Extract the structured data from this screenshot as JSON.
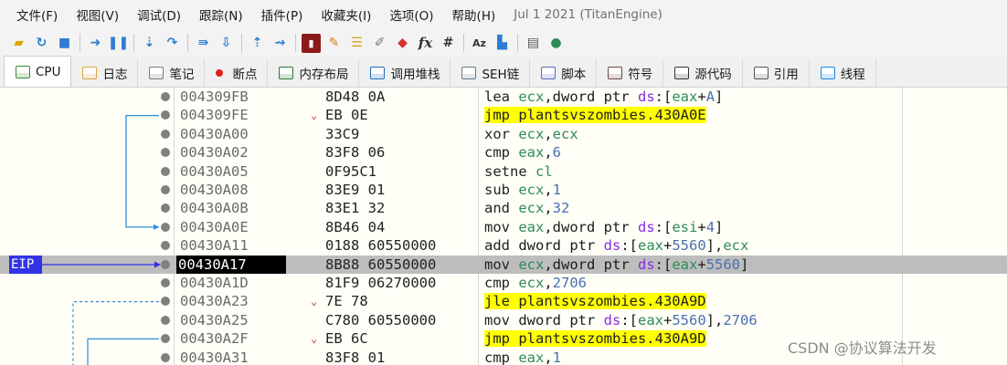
{
  "menu": {
    "items": [
      "文件(F)",
      "视图(V)",
      "调试(D)",
      "跟踪(N)",
      "插件(P)",
      "收藏夹(I)",
      "选项(O)",
      "帮助(H)"
    ],
    "build_date": "Jul 1 2021 (TitanEngine)"
  },
  "toolbar": {
    "icons": [
      "open-folder-icon",
      "restart-icon",
      "stop-icon",
      "run-icon",
      "pause-icon",
      "step-into-icon",
      "step-over-icon",
      "run-until-return-icon",
      "trace-icon",
      "trace-into-icon",
      "animate-icon",
      "console-icon",
      "highlight-icon",
      "patch-icon",
      "comment-icon",
      "label-icon",
      "bookmark-icon"
    ],
    "fx_label": "fx",
    "hash_label": "#",
    "az_label": "Aᴢ"
  },
  "tabs": [
    {
      "label": "CPU",
      "icon": "cpu-icon",
      "color": "#3a8a3a"
    },
    {
      "label": "日志",
      "icon": "log-icon",
      "color": "#d9a441"
    },
    {
      "label": "笔记",
      "icon": "notes-icon",
      "color": "#7a7a7a"
    },
    {
      "label": "断点",
      "icon": "breakpoint-icon",
      "color": "#e02020"
    },
    {
      "label": "内存布局",
      "icon": "memory-map-icon",
      "color": "#2e7d32"
    },
    {
      "label": "调用堆栈",
      "icon": "call-stack-icon",
      "color": "#1e6fb8"
    },
    {
      "label": "SEH链",
      "icon": "seh-chain-icon",
      "color": "#607d8b"
    },
    {
      "label": "脚本",
      "icon": "script-icon",
      "color": "#5c6bc0"
    },
    {
      "label": "符号",
      "icon": "symbols-icon",
      "color": "#6d4c41"
    },
    {
      "label": "源代码",
      "icon": "source-code-icon",
      "color": "#333333"
    },
    {
      "label": "引用",
      "icon": "references-icon",
      "color": "#555555"
    },
    {
      "label": "线程",
      "icon": "threads-icon",
      "color": "#1e88e5"
    }
  ],
  "eip_label": "EIP",
  "rows": [
    {
      "addr": "004309FB",
      "bytes": "8D48 0A",
      "jump": false,
      "tokens": [
        [
          "mn",
          "lea "
        ],
        [
          "reg",
          "ecx"
        ],
        [
          "kw",
          ","
        ],
        [
          "kw",
          "dword ptr "
        ],
        [
          "seg",
          "ds"
        ],
        [
          "kw",
          ":["
        ],
        [
          "reg",
          "eax"
        ],
        [
          "kw",
          "+"
        ],
        [
          "num",
          "A"
        ],
        [
          "kw",
          "]"
        ]
      ]
    },
    {
      "addr": "004309FE",
      "bytes": "EB 0E",
      "jump": true,
      "tokens": [
        [
          "mn",
          "jmp plantsvszombies.430A0E"
        ]
      ]
    },
    {
      "addr": "00430A00",
      "bytes": "33C9",
      "jump": false,
      "tokens": [
        [
          "mn",
          "xor "
        ],
        [
          "reg",
          "ecx"
        ],
        [
          "kw",
          ","
        ],
        [
          "reg",
          "ecx"
        ]
      ]
    },
    {
      "addr": "00430A02",
      "bytes": "83F8 06",
      "jump": false,
      "tokens": [
        [
          "mn",
          "cmp "
        ],
        [
          "reg",
          "eax"
        ],
        [
          "kw",
          ","
        ],
        [
          "num",
          "6"
        ]
      ]
    },
    {
      "addr": "00430A05",
      "bytes": "0F95C1",
      "jump": false,
      "tokens": [
        [
          "mn",
          "setne "
        ],
        [
          "reg",
          "cl"
        ]
      ]
    },
    {
      "addr": "00430A08",
      "bytes": "83E9 01",
      "jump": false,
      "tokens": [
        [
          "mn",
          "sub "
        ],
        [
          "reg",
          "ecx"
        ],
        [
          "kw",
          ","
        ],
        [
          "num",
          "1"
        ]
      ]
    },
    {
      "addr": "00430A0B",
      "bytes": "83E1 32",
      "jump": false,
      "tokens": [
        [
          "mn",
          "and "
        ],
        [
          "reg",
          "ecx"
        ],
        [
          "kw",
          ","
        ],
        [
          "num",
          "32"
        ]
      ]
    },
    {
      "addr": "00430A0E",
      "bytes": "8B46 04",
      "jump": false,
      "tokens": [
        [
          "mn",
          "mov "
        ],
        [
          "reg",
          "eax"
        ],
        [
          "kw",
          ","
        ],
        [
          "kw",
          "dword ptr "
        ],
        [
          "seg",
          "ds"
        ],
        [
          "kw",
          ":["
        ],
        [
          "reg",
          "esi"
        ],
        [
          "kw",
          "+"
        ],
        [
          "num",
          "4"
        ],
        [
          "kw",
          "]"
        ]
      ]
    },
    {
      "addr": "00430A11",
      "bytes": "0188 60550000",
      "jump": false,
      "tokens": [
        [
          "mn",
          "add "
        ],
        [
          "kw",
          "dword ptr "
        ],
        [
          "seg",
          "ds"
        ],
        [
          "kw",
          ":["
        ],
        [
          "reg",
          "eax"
        ],
        [
          "kw",
          "+"
        ],
        [
          "num",
          "5560"
        ],
        [
          "kw",
          "],"
        ],
        [
          "reg",
          "ecx"
        ]
      ]
    },
    {
      "addr": "00430A17",
      "bytes": "8B88 60550000",
      "jump": false,
      "current": true,
      "tokens": [
        [
          "mn",
          "mov "
        ],
        [
          "reg",
          "ecx"
        ],
        [
          "kw",
          ","
        ],
        [
          "kw",
          "dword ptr "
        ],
        [
          "seg",
          "ds"
        ],
        [
          "kw",
          ":["
        ],
        [
          "reg",
          "eax"
        ],
        [
          "kw",
          "+"
        ],
        [
          "num",
          "5560"
        ],
        [
          "kw",
          "]"
        ]
      ]
    },
    {
      "addr": "00430A1D",
      "bytes": "81F9 06270000",
      "jump": false,
      "tokens": [
        [
          "mn",
          "cmp "
        ],
        [
          "reg",
          "ecx"
        ],
        [
          "kw",
          ","
        ],
        [
          "num",
          "2706"
        ]
      ]
    },
    {
      "addr": "00430A23",
      "bytes": "7E 78",
      "jump": true,
      "tokens": [
        [
          "mn",
          "jle plantsvszombies.430A9D"
        ]
      ]
    },
    {
      "addr": "00430A25",
      "bytes": "C780 60550000",
      "jump": false,
      "tokens": [
        [
          "mn",
          "mov "
        ],
        [
          "kw",
          "dword ptr "
        ],
        [
          "seg",
          "ds"
        ],
        [
          "kw",
          ":["
        ],
        [
          "reg",
          "eax"
        ],
        [
          "kw",
          "+"
        ],
        [
          "num",
          "5560"
        ],
        [
          "kw",
          "],"
        ],
        [
          "num",
          "2706"
        ]
      ]
    },
    {
      "addr": "00430A2F",
      "bytes": "EB 6C",
      "jump": true,
      "tokens": [
        [
          "mn",
          "jmp plantsvszombies.430A9D"
        ]
      ]
    },
    {
      "addr": "00430A31",
      "bytes": "83F8 01",
      "jump": false,
      "tokens": [
        [
          "mn",
          "cmp "
        ],
        [
          "reg",
          "eax"
        ],
        [
          "kw",
          ","
        ],
        [
          "num",
          "1"
        ]
      ]
    }
  ],
  "watermark": "CSDN @协议算法开发"
}
